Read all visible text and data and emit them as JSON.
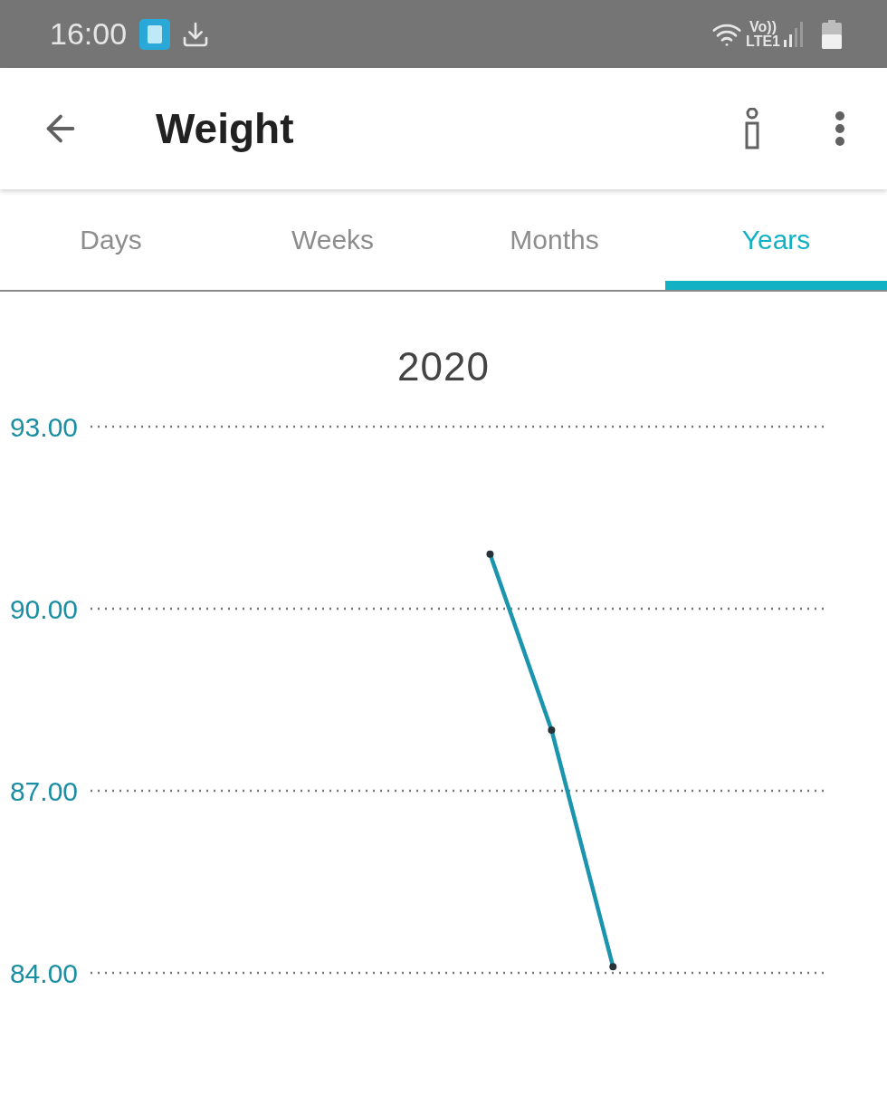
{
  "status_bar": {
    "time": "16:00",
    "network_top": "Vo))",
    "network_bottom": "LTE1"
  },
  "app_bar": {
    "title": "Weight"
  },
  "tabs": [
    {
      "label": "Days",
      "selected": false
    },
    {
      "label": "Weeks",
      "selected": false
    },
    {
      "label": "Months",
      "selected": false
    },
    {
      "label": "Years",
      "selected": true
    }
  ],
  "chart": {
    "title": "2020",
    "chart_data": {
      "type": "line",
      "categories": [
        null,
        null,
        null,
        null,
        null,
        null,
        null,
        null,
        null,
        null,
        null,
        null
      ],
      "ylim": [
        84,
        93
      ],
      "yticks": [
        {
          "value": 93,
          "label": "93.00"
        },
        {
          "value": 90,
          "label": "90.00"
        },
        {
          "value": 87,
          "label": "87.00"
        },
        {
          "value": 84,
          "label": "84.00"
        }
      ],
      "series": [
        {
          "color": "#1a95ad",
          "marker": "circle",
          "values": [
            null,
            null,
            null,
            null,
            null,
            null,
            90.9,
            88.0,
            84.1,
            null,
            null,
            null
          ]
        }
      ]
    }
  }
}
